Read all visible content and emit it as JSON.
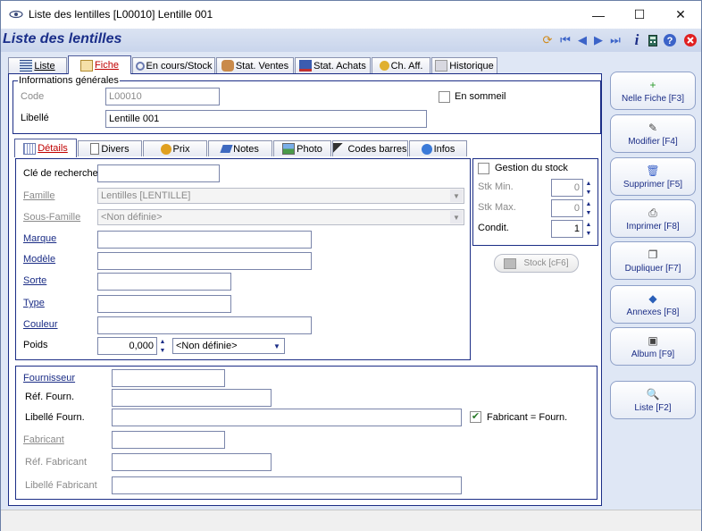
{
  "window": {
    "title": "Liste des lentilles  [L00010] Lentille 001",
    "minimize": "—",
    "maximize": "☐",
    "close": "✕"
  },
  "header": {
    "title": "Liste des lentilles",
    "icons": [
      "refresh-icon",
      "first-icon",
      "prev-icon",
      "next-icon",
      "last-icon",
      "info-icon",
      "calculator-icon",
      "help-icon",
      "close-icon"
    ]
  },
  "main_tabs": [
    {
      "label": "Liste"
    },
    {
      "label": "Fiche",
      "active": true
    },
    {
      "label": "En cours/Stock"
    },
    {
      "label": "Stat. Ventes"
    },
    {
      "label": "Stat. Achats"
    },
    {
      "label": "Ch. Aff."
    },
    {
      "label": "Historique"
    }
  ],
  "general": {
    "legend": "Informations générales",
    "code_label": "Code",
    "code_value": "L00010",
    "libelle_label": "Libellé",
    "libelle_value": "Lentille 001",
    "sommeil_label": "En sommeil"
  },
  "sub_tabs": [
    {
      "label": "Détails",
      "active": true
    },
    {
      "label": "Divers"
    },
    {
      "label": "Prix"
    },
    {
      "label": "Notes"
    },
    {
      "label": "Photo"
    },
    {
      "label": "Codes barres"
    },
    {
      "label": "Infos"
    }
  ],
  "details": {
    "cle_label": "Clé de recherche",
    "cle_value": "",
    "famille_label": "Famille",
    "famille_value": "Lentilles [LENTILLE]",
    "sousfamille_label": "Sous-Famille",
    "sousfamille_value": "<Non définie>",
    "marque_label": "Marque",
    "modele_label": "Modèle",
    "sorte_label": "Sorte",
    "type_label": "Type",
    "couleur_label": "Couleur",
    "poids_label": "Poids",
    "poids_value": "0,000",
    "poids_unit": "<Non définie>"
  },
  "stock": {
    "gestion_label": "Gestion du stock",
    "min_label": "Stk Min.",
    "min_value": "0",
    "max_label": "Stk Max.",
    "max_value": "0",
    "condit_label": "Condit.",
    "condit_value": "1",
    "stock_button": "Stock [cF6]"
  },
  "supplier": {
    "fournisseur_label": "Fournisseur",
    "ref_fourn_label": "Réf. Fourn.",
    "libelle_fourn_label": "Libellé Fourn.",
    "fabricant_eq_label": "Fabricant = Fourn.",
    "fabricant_label": "Fabricant",
    "ref_fabricant_label": "Réf. Fabricant",
    "libelle_fabricant_label": "Libellé Fabricant"
  },
  "side_buttons": [
    {
      "label": "Nelle Fiche [F3]",
      "icon": "new-file-icon"
    },
    {
      "label": "Modifier [F4]",
      "icon": "edit-icon"
    },
    {
      "label": "Supprimer [F5]",
      "icon": "trash-icon"
    },
    {
      "label": "Imprimer [F8]",
      "icon": "printer-icon"
    },
    {
      "label": "Dupliquer [F7]",
      "icon": "duplicate-icon"
    },
    {
      "label": "Annexes [F8]",
      "icon": "attachment-icon"
    },
    {
      "label": "Album [F9]",
      "icon": "album-icon"
    },
    {
      "label": "Liste [F2]",
      "icon": "search-list-icon"
    }
  ],
  "colors": {
    "accent": "#1b2d86",
    "header_bg": "#c9d5ec",
    "active_tab_text": "#c00000"
  }
}
